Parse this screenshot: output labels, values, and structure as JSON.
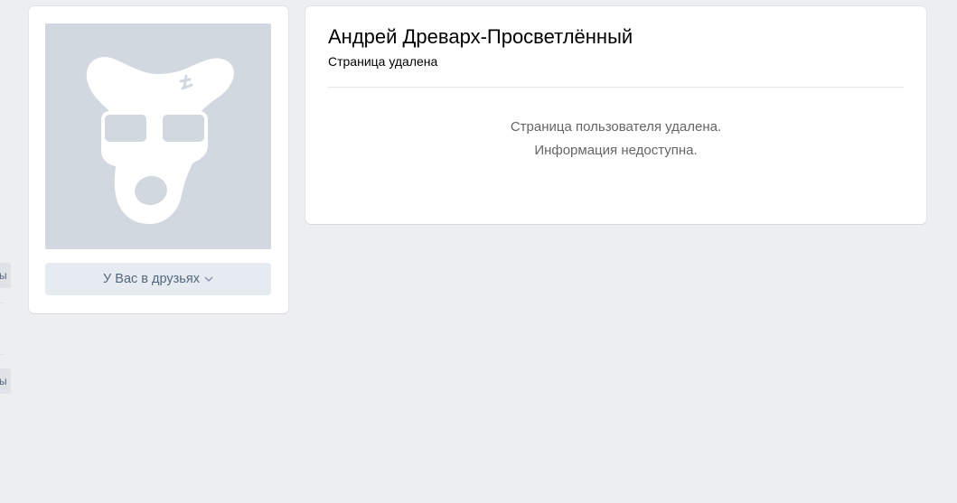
{
  "sidebar_edge": {
    "button_1_label": "ы",
    "button_2_label": "ы"
  },
  "avatar_card": {
    "avatar_icon": "deactivated-dog-icon",
    "friends_button_label": "У Вас в друзьях",
    "friends_button_icon": "chevron-down-icon"
  },
  "profile": {
    "name": "Андрей Древарх-Просветлённый",
    "status": "Страница удалена",
    "message_line_1": "Страница пользователя удалена.",
    "message_line_2": "Информация недоступна."
  },
  "colors": {
    "background": "#edeef0",
    "card": "#ffffff",
    "avatar_bg": "#d1d8e0",
    "button_bg": "#e5ebf1",
    "button_text": "#55677d",
    "muted_text": "#656565"
  }
}
